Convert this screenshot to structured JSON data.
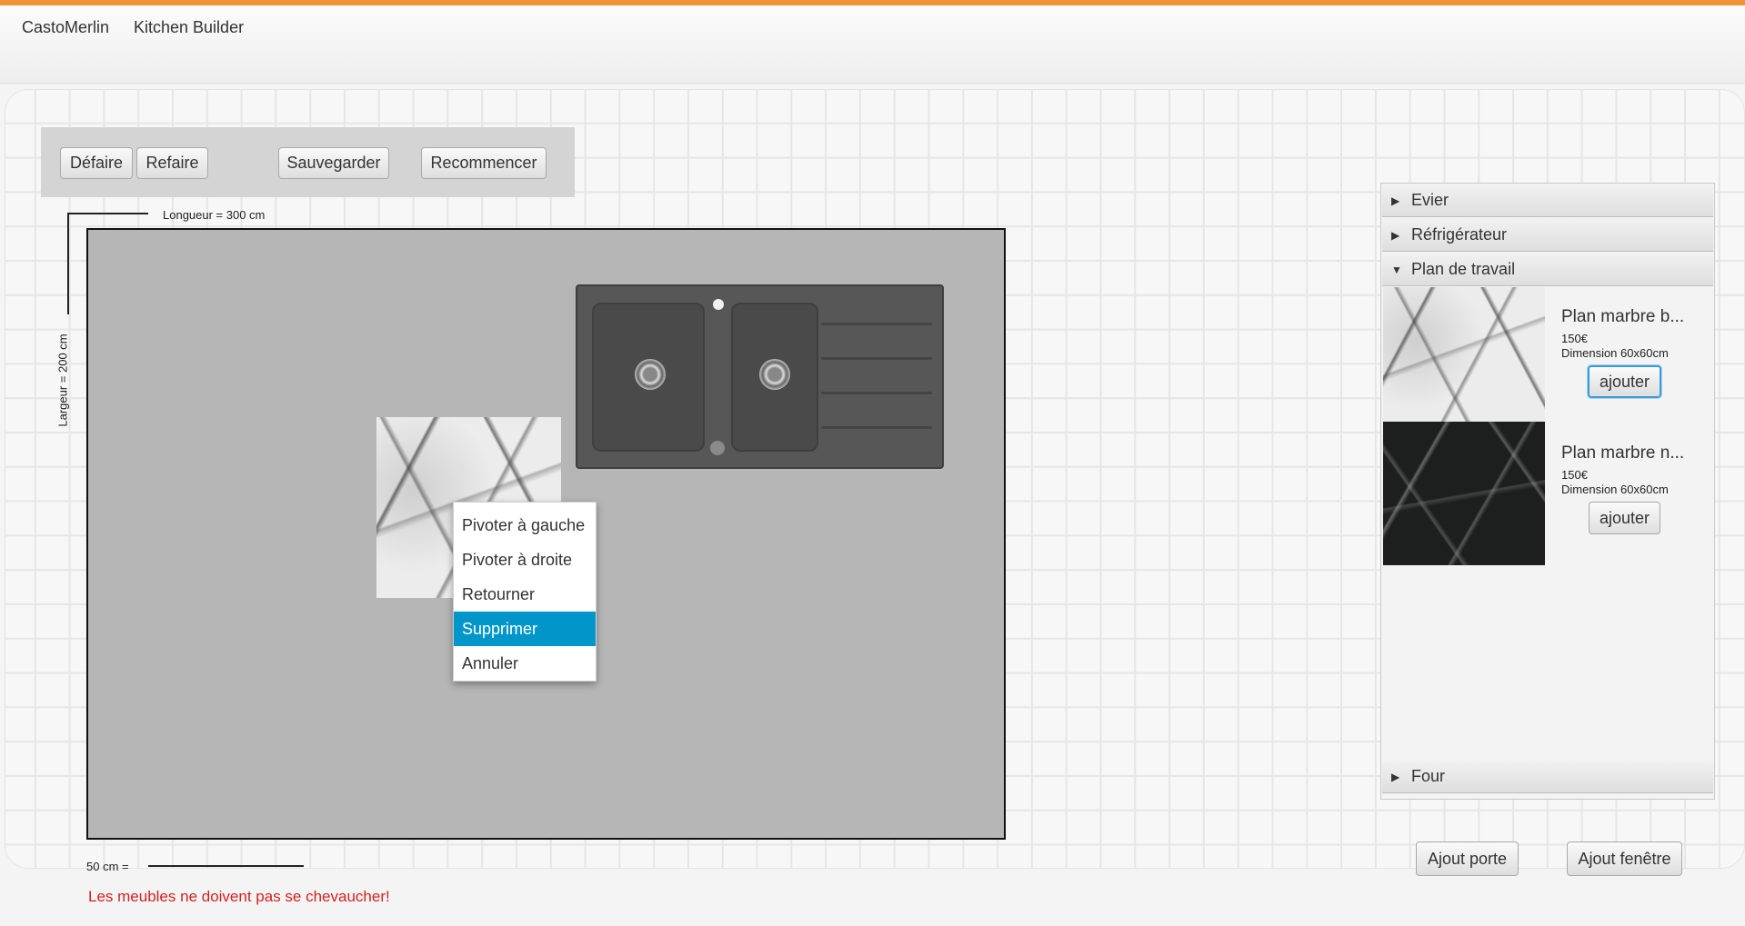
{
  "menubar": {
    "items": [
      "CastoMerlin",
      "Kitchen Builder"
    ]
  },
  "toolbar": {
    "undo": "Défaire",
    "redo": "Refaire",
    "save": "Sauvegarder",
    "restart": "Recommencer"
  },
  "dimensions": {
    "length": "Longueur = 300 cm",
    "width": "Largeur = 200 cm",
    "scale": "50 cm ="
  },
  "context_menu": {
    "items": [
      "Pivoter à gauche",
      "Pivoter à droite",
      "Retourner",
      "Supprimer",
      "Annuler"
    ],
    "highlighted": "Supprimer"
  },
  "catalog": {
    "categories": [
      "Evier",
      "Réfrigérateur",
      "Plan de travail",
      "Four"
    ],
    "expanded": "Plan de travail",
    "products": [
      {
        "name": "Plan marbre b...",
        "price": "150€",
        "dimension": "Dimension 60x60cm",
        "button": "ajouter",
        "image": "white-marble"
      },
      {
        "name": "Plan marbre n...",
        "price": "150€",
        "dimension": "Dimension 60x60cm",
        "button": "ajouter",
        "image": "black-marble"
      }
    ]
  },
  "bottom_buttons": {
    "door": "Ajout porte",
    "window": "Ajout fenêtre"
  },
  "error_message": "Les meubles ne doivent pas se chevaucher!",
  "colors": {
    "accent_bar": "#f0923a",
    "menu_highlight": "#0096c9",
    "error": "#d42020"
  }
}
